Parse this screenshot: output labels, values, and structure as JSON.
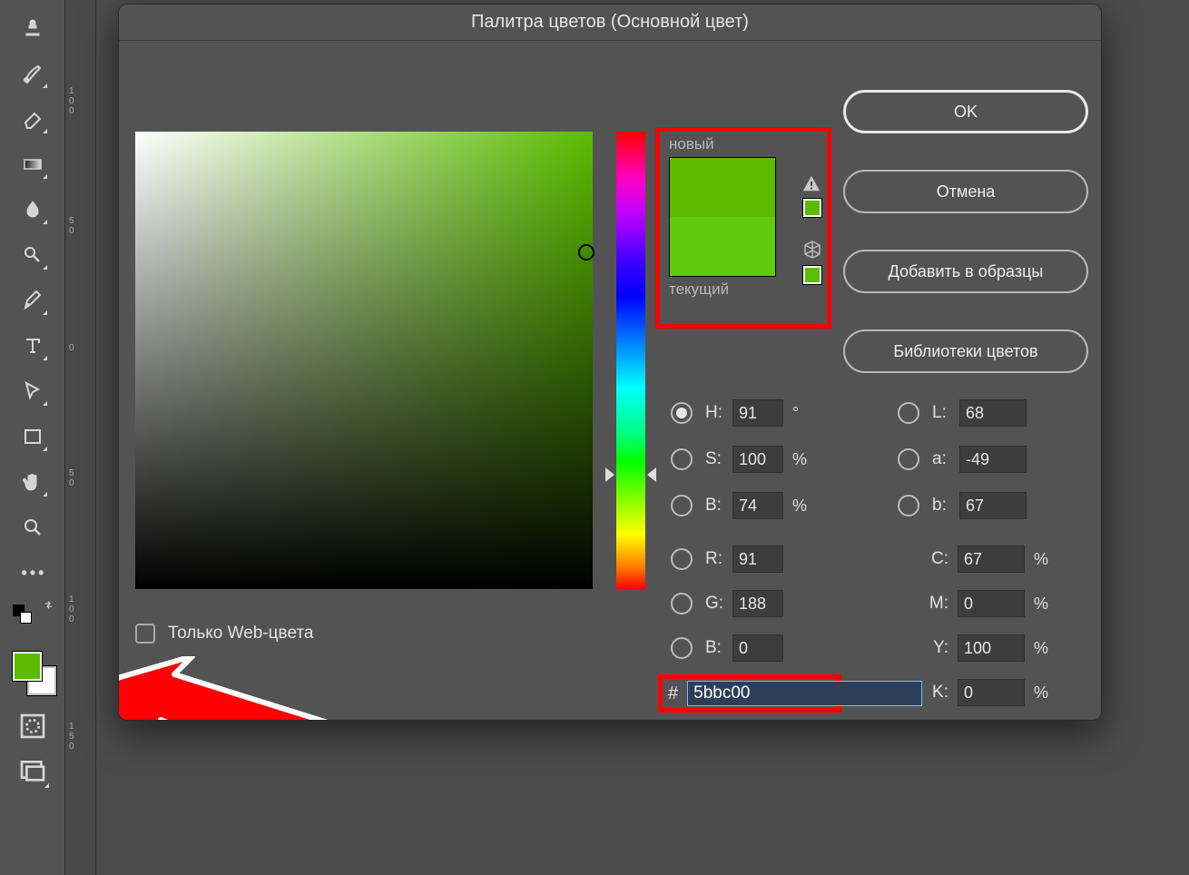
{
  "dialog_title": "Палитра цветов (Основной цвет)",
  "buttons": {
    "ok": "OK",
    "cancel": "Отмена",
    "add_swatch": "Добавить в образцы",
    "libraries": "Библиотеки цветов"
  },
  "new_current": {
    "new_label": "новый",
    "current_label": "текущий",
    "new_color": "#5bbc00",
    "current_color": "#63c90d"
  },
  "hsb": {
    "h_label": "H:",
    "h_value": "91",
    "h_unit": "°",
    "s_label": "S:",
    "s_value": "100",
    "s_unit": "%",
    "b_label": "B:",
    "b_value": "74",
    "b_unit": "%"
  },
  "rgb": {
    "r_label": "R:",
    "r_value": "91",
    "g_label": "G:",
    "g_value": "188",
    "b_label": "B:",
    "b_value": "0"
  },
  "lab": {
    "l_label": "L:",
    "l_value": "68",
    "a_label": "a:",
    "a_value": "-49",
    "b_label": "b:",
    "b_value": "67"
  },
  "cmyk": {
    "c_label": "C:",
    "c_value": "67",
    "c_unit": "%",
    "m_label": "M:",
    "m_value": "0",
    "m_unit": "%",
    "y_label": "Y:",
    "y_value": "100",
    "y_unit": "%",
    "k_label": "K:",
    "k_value": "0",
    "k_unit": "%"
  },
  "hex": {
    "label": "#",
    "value": "5bbc00"
  },
  "web_only_label": "Только Web-цвета",
  "ruler_labels": {
    "a": "1\n0\n0",
    "b": "5\n0",
    "c": "0",
    "d": "5\n0",
    "e": "1\n0\n0",
    "f": "1\n5\n0"
  },
  "selected_color": "#5bbc00"
}
